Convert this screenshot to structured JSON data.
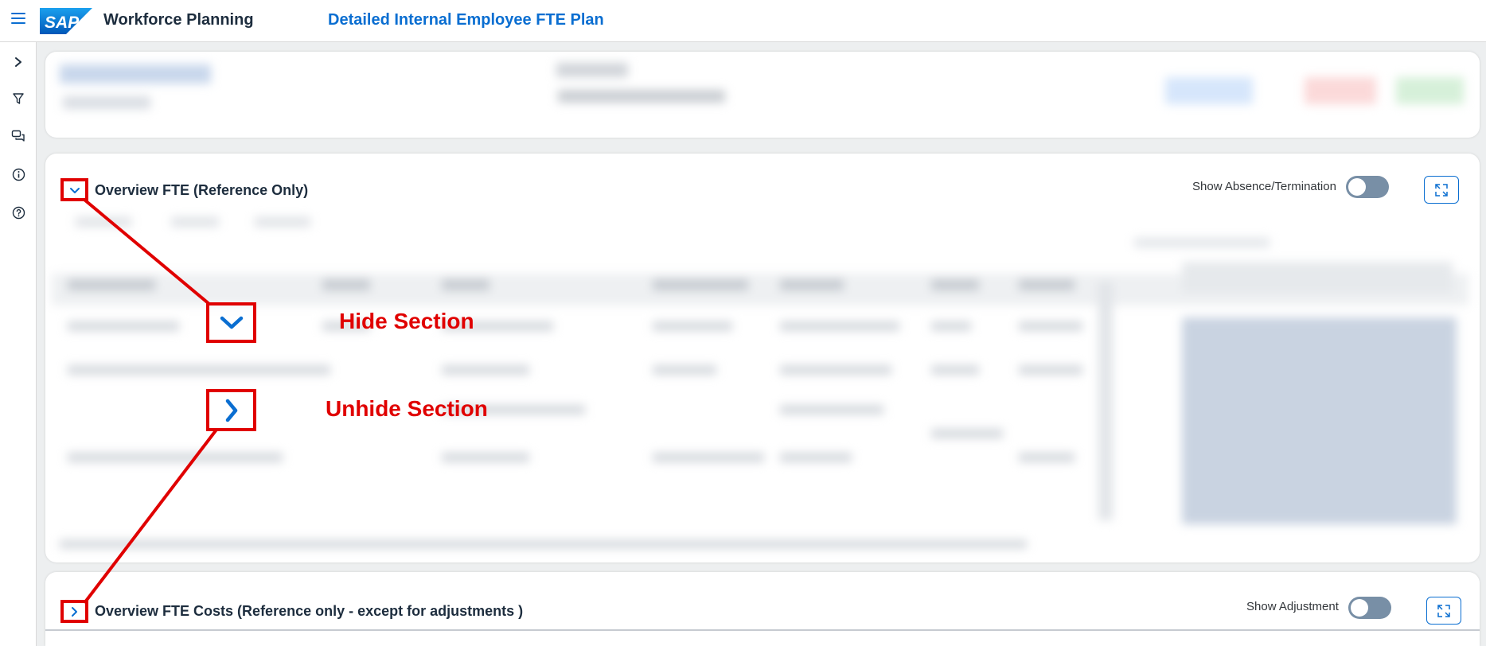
{
  "shell": {
    "brand": "SAP",
    "app_title": "Workforce Planning",
    "page_heading": "Detailed Internal Employee FTE Plan"
  },
  "sidenav": {
    "items": [
      "expand-icon",
      "filter-icon",
      "comments-icon",
      "info-icon",
      "help-icon"
    ]
  },
  "sections": {
    "fte": {
      "title": "Overview FTE (Reference Only)",
      "toggle_label": "Show Absence/Termination",
      "toggle_on": false
    },
    "costs": {
      "title": "Overview FTE Costs (Reference only - except for adjustments )",
      "toggle_label": "Show Adjustment",
      "toggle_on": false
    }
  },
  "annotations": {
    "hide": "Hide Section",
    "unhide": "Unhide Section",
    "color": "#e00000"
  },
  "colors": {
    "accent": "#0a6ed1",
    "shell_bg": "#ffffff",
    "page_bg": "#edeff0"
  }
}
